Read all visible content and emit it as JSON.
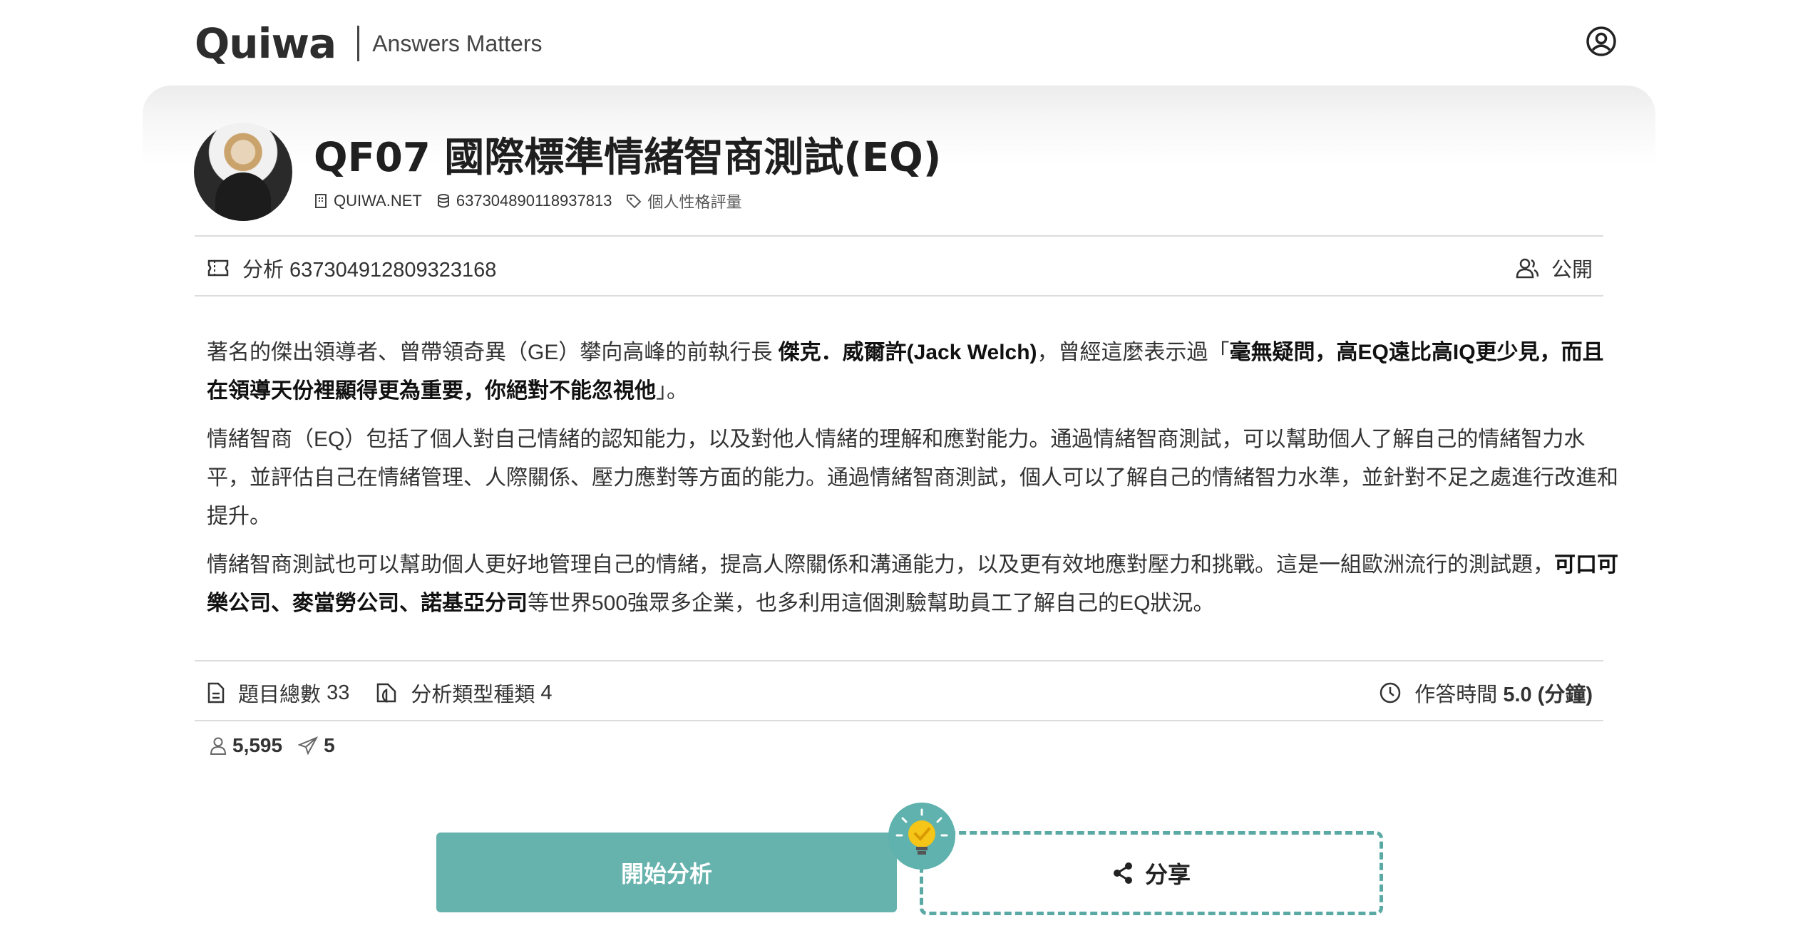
{
  "header": {
    "logo": "Quiwa",
    "tagline": "Answers Matters"
  },
  "quiz": {
    "title": "QF07 國際標準情緒智商測試(EQ)",
    "site": "QUIWA.NET",
    "id": "637304890118937813",
    "category": "個人性格評量"
  },
  "analysis_bar": {
    "label": "分析 637304912809323168",
    "visibility": "公開"
  },
  "description": {
    "p1_a": "著名的傑出領導者、曾帶領奇異（GE）攀向高峰的前執行長 ",
    "p1_b": "傑克．威爾許(Jack Welch)",
    "p1_c": "，曾經這麼表示過「",
    "p1_d": "毫無疑問，高EQ遠比高IQ更少見，而且在領導天份裡顯得更為重要，你絕對不能忽視他",
    "p1_e": "」。",
    "p2": "情緒智商（EQ）包括了個人對自己情緒的認知能力，以及對他人情緒的理解和應對能力。通過情緒智商測試，可以幫助個人了解自己的情緒智力水平，並評估自己在情緒管理、人際關係、壓力應對等方面的能力。通過情緒智商測試，個人可以了解自己的情緒智力水準，並針對不足之處進行改進和提升。",
    "p3_a": "情緒智商測試也可以幫助個人更好地管理自己的情緒，提高人際關係和溝通能力，以及更有效地應對壓力和挑戰。這是一組歐洲流行的測試題，",
    "p3_b": "可口可樂公司、麥當勞公司、諾基亞分司",
    "p3_c": "等世界500強眾多企業，也多利用這個測驗幫助員工了解自己的EQ狀況。"
  },
  "info_bar": {
    "questions_label": "題目總數",
    "questions_value": "33",
    "types_label": "分析類型種類",
    "types_value": "4",
    "time_label": "作答時間",
    "time_value": "5.0 (分鐘)"
  },
  "stats": {
    "users": "5,595",
    "shares": "5"
  },
  "actions": {
    "start": "開始分析",
    "share": "分享"
  },
  "colors": {
    "accent": "#66b2ad",
    "dashed_border": "#5aa9a4",
    "bulb": "#f5c518"
  }
}
